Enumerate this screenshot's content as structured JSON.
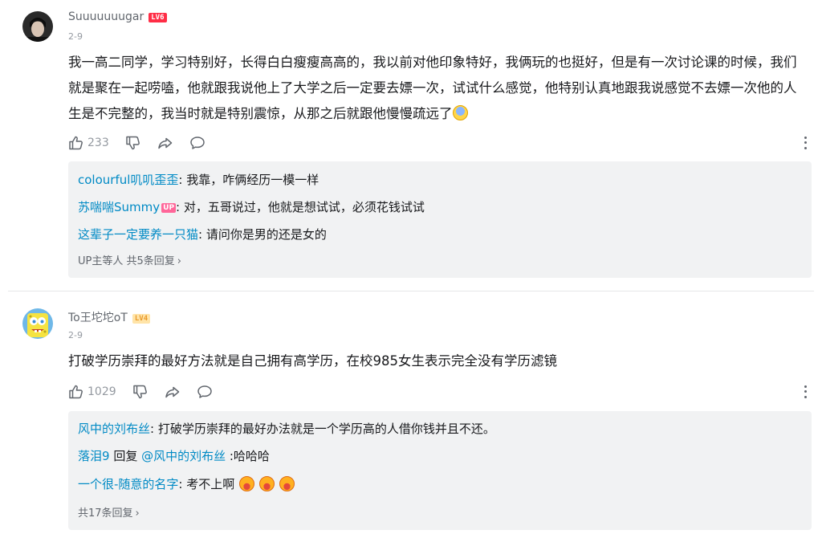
{
  "comments": [
    {
      "user": "Suuuuuuugar",
      "level": "LV6",
      "date": "2-9",
      "content": "我一高二同学，学习特别好，长得白白瘦瘦高高的，我以前对他印象特好，我俩玩的也挺好，但是有一次讨论课的时候，我们就是聚在一起唠嗑，他就跟我说他上了大学之后一定要去嫖一次，试试什么感觉，他特别认真地跟我说感觉不去嫖一次他的人生是不完整的，我当时就是特别震惊，从那之后就跟他慢慢疏远了",
      "emoji": "fearful-emoji",
      "likes": "233",
      "replies": [
        {
          "name": "colourful叽叽歪歪",
          "text": ": 我靠，咋俩经历一模一样"
        },
        {
          "name": "苏喘喘Summy",
          "badge": "UP",
          "text": ": 对，五哥说过，他就是想试试，必须花钱试试"
        },
        {
          "name": "这辈子一定要养一只猫",
          "text": ": 请问你是男的还是女的"
        }
      ],
      "more_prefix": "UP主等人",
      "more_text": "共5条回复"
    },
    {
      "user": "To王坨坨oT",
      "level": "LV4",
      "date": "2-9",
      "content": "打破学历崇拜的最好方法就是自己拥有高学历，在校985女生表示完全没有学历滤镜",
      "likes": "1029",
      "replies": [
        {
          "name": "风中的刘布丝",
          "text": ": 打破学历崇拜的最好办法就是一个学历高的人借你钱并且不还。"
        },
        {
          "name": "落泪9",
          "reply_word": " 回复 ",
          "mention": "@风中的刘布丝",
          "text": " :哈哈哈"
        },
        {
          "name": "一个很-随意的名字",
          "text": ": 考不上啊"
        }
      ],
      "more_text": "共17条回复"
    }
  ],
  "colors": {
    "link": "#008ac5",
    "reply_bg": "#f1f2f3",
    "level6": "#ff2d46",
    "up_badge": "#ff6699"
  },
  "icons": [
    "thumbs-up-icon",
    "thumbs-down-icon",
    "share-icon",
    "comment-icon",
    "more-icon",
    "chevron-right-icon"
  ]
}
